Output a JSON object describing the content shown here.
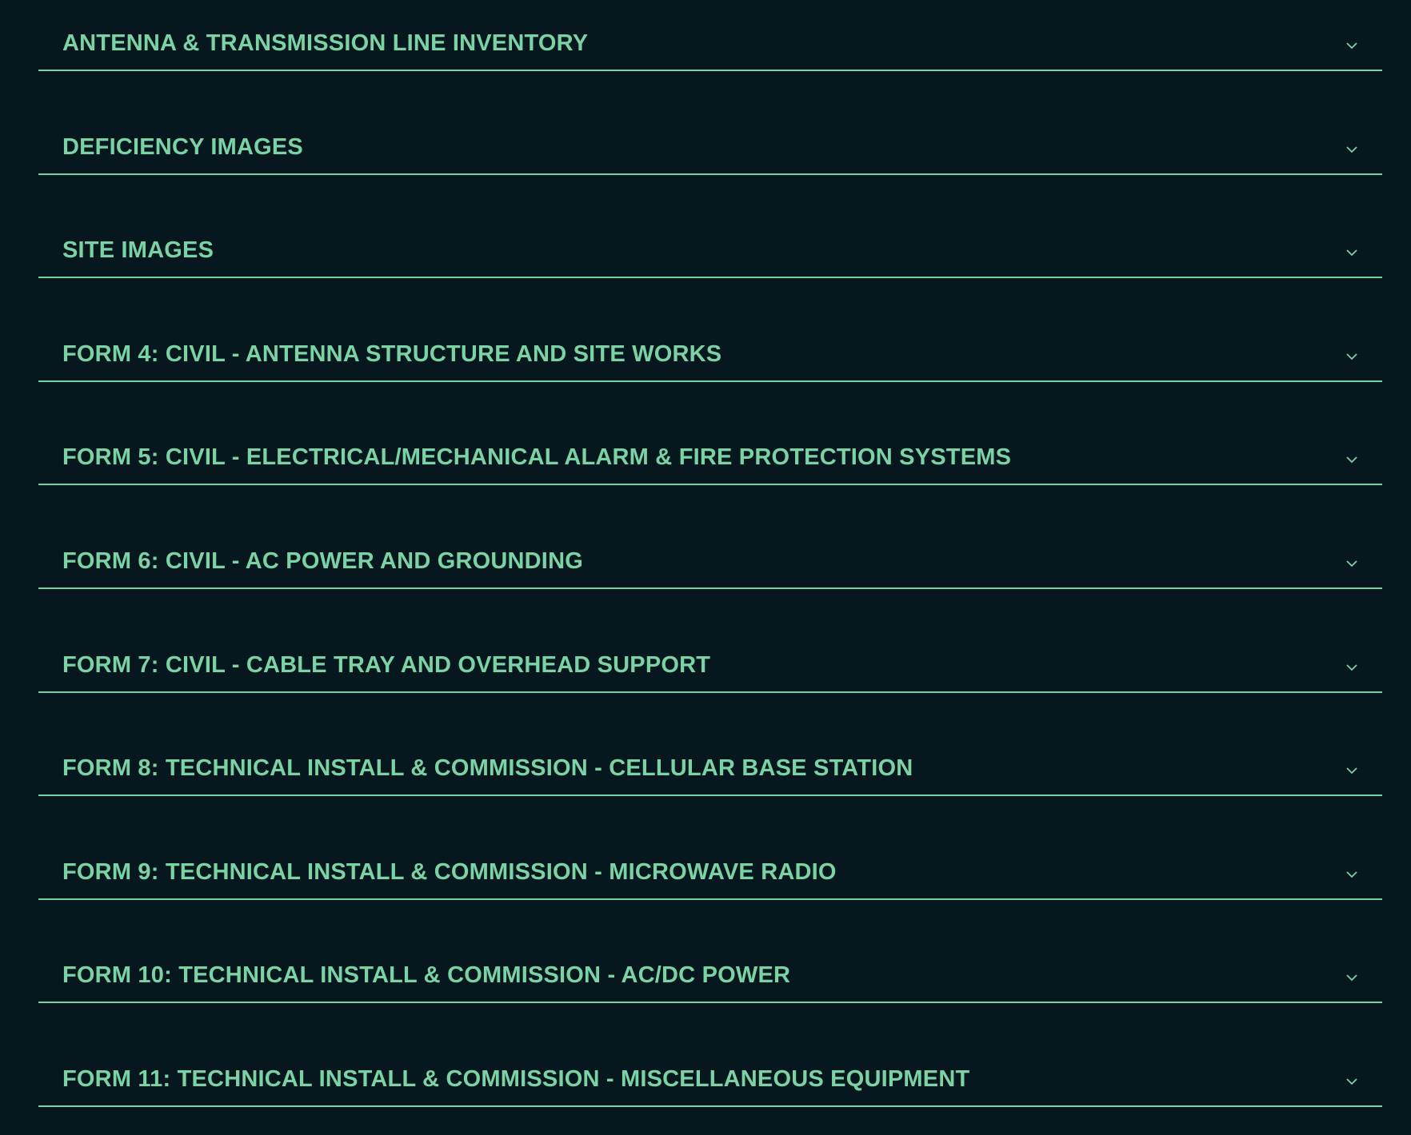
{
  "accent_color": "#7ad2a5",
  "background_color": "#06181d",
  "accordion": {
    "items": [
      {
        "label": "ANTENNA & TRANSMISSION LINE INVENTORY",
        "icon": "chevron-down-icon"
      },
      {
        "label": "DEFICIENCY IMAGES",
        "icon": "chevron-down-icon"
      },
      {
        "label": "SITE IMAGES",
        "icon": "chevron-down-icon"
      },
      {
        "label": "FORM 4: CIVIL - ANTENNA STRUCTURE AND SITE WORKS",
        "icon": "chevron-down-icon"
      },
      {
        "label": "FORM 5: CIVIL - ELECTRICAL/MECHANICAL ALARM & FIRE PROTECTION SYSTEMS",
        "icon": "chevron-down-icon"
      },
      {
        "label": "FORM 6: CIVIL - AC POWER AND GROUNDING",
        "icon": "chevron-down-icon"
      },
      {
        "label": "FORM 7: CIVIL - CABLE TRAY AND OVERHEAD SUPPORT",
        "icon": "chevron-down-icon"
      },
      {
        "label": "FORM 8: TECHNICAL INSTALL & COMMISSION - CELLULAR BASE STATION",
        "icon": "chevron-down-icon"
      },
      {
        "label": "FORM 9: TECHNICAL INSTALL & COMMISSION - MICROWAVE RADIO",
        "icon": "chevron-down-icon"
      },
      {
        "label": "FORM 10: TECHNICAL INSTALL & COMMISSION - AC/DC POWER",
        "icon": "chevron-down-icon"
      },
      {
        "label": "FORM 11: TECHNICAL INSTALL & COMMISSION - MISCELLANEOUS EQUIPMENT",
        "icon": "chevron-down-icon"
      }
    ]
  }
}
